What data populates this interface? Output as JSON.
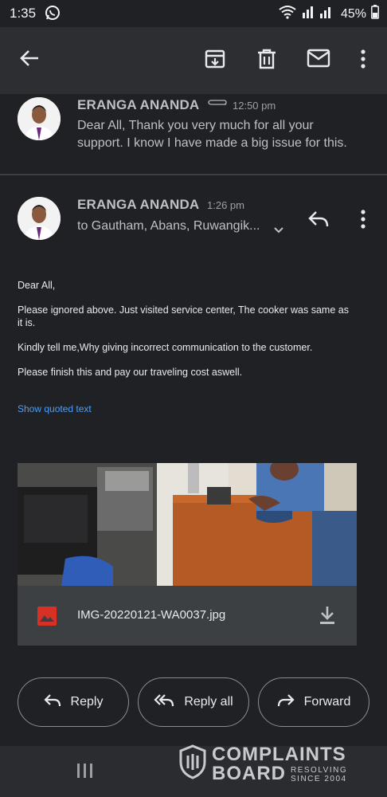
{
  "status_bar": {
    "time": "1:35",
    "battery": "45%"
  },
  "thread": [
    {
      "sender": "ERANGA ANANDA",
      "time": "12:50 pm",
      "snippet_line1": "Dear All, Thank you very much for all your",
      "snippet_line2": "support. I know I have made a big issue for this."
    },
    {
      "sender": "ERANGA ANANDA",
      "time": "1:26 pm",
      "recipients": "to Gautham, Abans, Ruwangik...",
      "body": {
        "greeting": "Dear All,",
        "p1_line1": "Please ignored above. Just visited service center, The cooker was same as",
        "p1_line2": "it is.",
        "p2": "Kindly tell me,Why giving incorrect communication to the customer.",
        "p3": "Please finish this and pay our traveling cost aswell."
      },
      "show_quoted_label": "Show quoted text",
      "attachment": {
        "filename": "IMG-20220121-WA0037.jpg"
      }
    }
  ],
  "actions": {
    "reply": "Reply",
    "reply_all": "Reply all",
    "forward": "Forward"
  },
  "watermark": {
    "line1": "COMPLAINTS",
    "line2": "BOARD",
    "tag1": "RESOLVING",
    "tag2": "SINCE 2004"
  },
  "colors": {
    "background": "#202124",
    "appbar": "#2d2e31",
    "link": "#4e9ef5",
    "image_icon": "#d93025"
  }
}
